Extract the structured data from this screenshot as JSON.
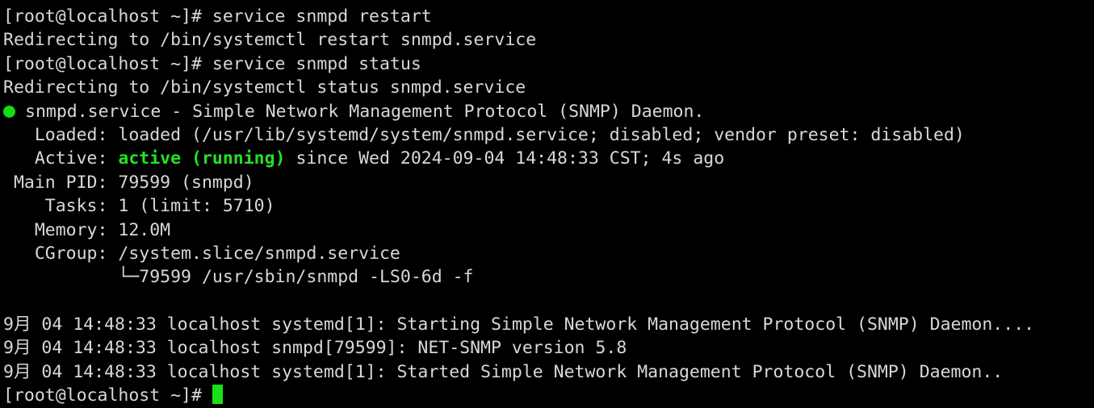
{
  "terminal": {
    "background_color": "#000000",
    "foreground_color": "#d8d8d8",
    "accent_green": "#26e026",
    "cursor_color": "#18e018",
    "prompt": "[root@localhost ~]# ",
    "lines": {
      "cmd_restart": "[root@localhost ~]# service snmpd restart",
      "redirect_restart": "Redirecting to /bin/systemctl restart snmpd.service",
      "cmd_status": "[root@localhost ~]# service snmpd status",
      "redirect_status": "Redirecting to /bin/systemctl status snmpd.service",
      "unit_header": "snmpd.service - Simple Network Management Protocol (SNMP) Daemon.",
      "loaded_label": "   Loaded: ",
      "loaded_value": "loaded (/usr/lib/systemd/system/snmpd.service; disabled; vendor preset: disabled)",
      "active_label": "   Active: ",
      "active_state": "active (running)",
      "active_since": " since Wed 2024-09-04 14:48:33 CST; 4s ago",
      "main_pid": " Main PID: 79599 (snmpd)",
      "tasks": "    Tasks: 1 (limit: 5710)",
      "memory": "   Memory: 12.0M",
      "cgroup": "   CGroup: /system.slice/snmpd.service",
      "cgroup_tree": "           └─79599 /usr/sbin/snmpd -LS0-6d -f",
      "blank": " ",
      "log1": "9月 04 14:48:33 localhost systemd[1]: Starting Simple Network Management Protocol (SNMP) Daemon....",
      "log2": "9月 04 14:48:33 localhost snmpd[79599]: NET-SNMP version 5.8",
      "log3": "9月 04 14:48:33 localhost systemd[1]: Started Simple Network Management Protocol (SNMP) Daemon..",
      "final_prompt": "[root@localhost ~]# "
    }
  }
}
